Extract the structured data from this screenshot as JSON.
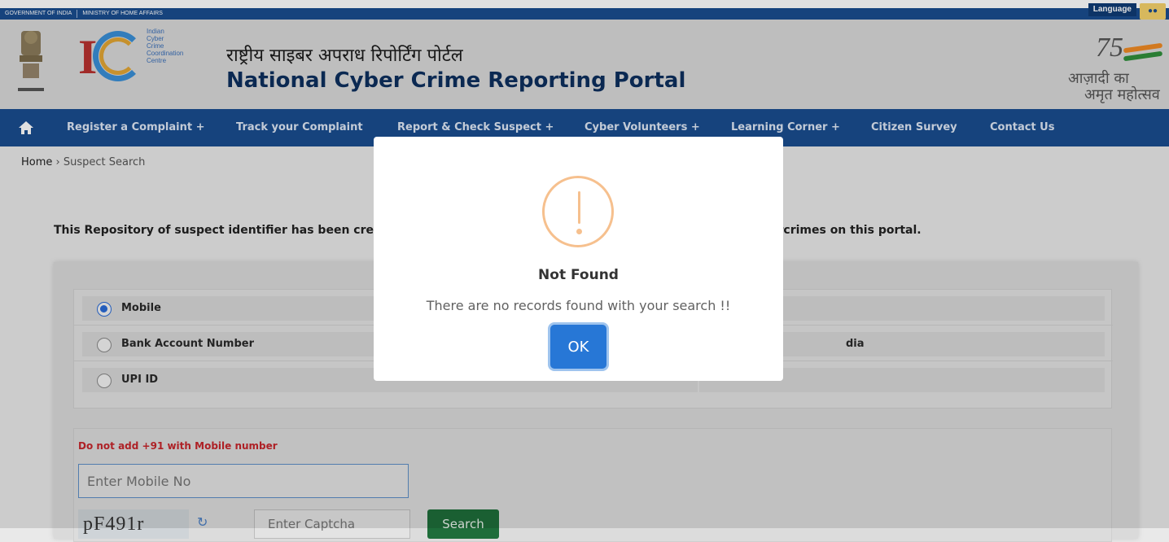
{
  "topbar": {
    "gov": "GOVERNMENT OF INDIA",
    "ministry": "MINISTRY OF HOME AFFAIRS",
    "language": "Language"
  },
  "header": {
    "i4c_words": [
      "Indian",
      "Cyber",
      "Crime",
      "Coordination",
      "Centre"
    ],
    "title_hindi": "राष्ट्रीय साइबर अपराध रिपोर्टिंग पोर्टल",
    "title_english": "National Cyber Crime Reporting Portal",
    "azadi_line1": "आज़ादी का",
    "azadi_line2": "अमृत महोत्सव"
  },
  "nav": {
    "items": [
      "Register a Complaint +",
      "Track your Complaint",
      "Report & Check Suspect +",
      "Cyber Volunteers +",
      "Learning Corner +",
      "Citizen Survey",
      "Contact Us"
    ]
  },
  "breadcrumb": {
    "home": "Home",
    "current": "› Suspect Search"
  },
  "content": {
    "intro_left": "This Repository of suspect identifier has been cre",
    "intro_right": "ercrimes on this portal.",
    "options": [
      {
        "label": "Mobile",
        "selected": true
      },
      {
        "label": "Bank Account Number",
        "selected": false
      },
      {
        "label": "UPI ID",
        "selected": false
      }
    ],
    "option_right_row2": "dia",
    "warning": "Do not add +91 with Mobile number",
    "mobile_placeholder": "Enter Mobile No",
    "captcha_text": "pF491r",
    "captcha_placeholder": "Enter Captcha",
    "search_label": "Search"
  },
  "modal": {
    "title": "Not Found",
    "message": "There are no records found with your search !!",
    "ok_label": "OK",
    "accent": "#f6c08e",
    "button_color": "#2777d6"
  }
}
